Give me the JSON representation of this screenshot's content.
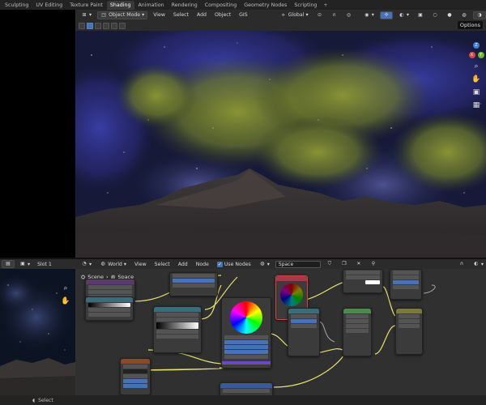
{
  "workspace_tabs": [
    "Sculpting",
    "UV Editing",
    "Texture Paint",
    "Shading",
    "Animation",
    "Rendering",
    "Compositing",
    "Geometry Nodes",
    "Scripting"
  ],
  "workspace_active": "Shading",
  "viewport": {
    "mode": "Object Mode",
    "menus": [
      "View",
      "Select",
      "Add",
      "Object",
      "GIS"
    ],
    "transform_orientation": "Global",
    "options_label": "Options",
    "gizmo": {
      "x_color": "#e0443a",
      "y_color": "#6dbb2a",
      "z_color": "#3d7fe0"
    }
  },
  "image_editor": {
    "slot": "Slot 1"
  },
  "node_editor": {
    "world_label": "World",
    "menus": [
      "View",
      "Select",
      "Add",
      "Node"
    ],
    "use_nodes_label": "Use Nodes",
    "space_value": "Space",
    "breadcrumb": [
      "Scene",
      "Space"
    ]
  },
  "status": {
    "select_label": "Select"
  },
  "colors": {
    "accent": "#4772b3",
    "active_tab": "#3a3a3a",
    "header": "#2b2b2b",
    "node_bg": "#3b3b3b",
    "wire": "#e6e26a"
  }
}
